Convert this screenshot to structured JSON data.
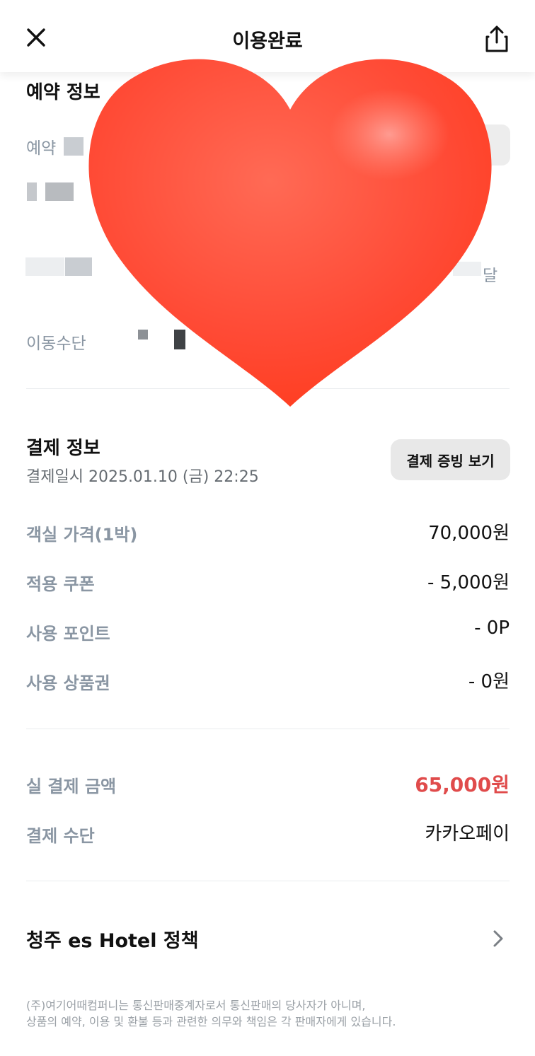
{
  "header": {
    "title": "이용완료",
    "close_icon": "close-icon",
    "share_icon": "share-icon"
  },
  "reservation": {
    "section_title": "예약 정보",
    "label_reservation_partial": "예약",
    "label_transport": "이동수단",
    "right_text_partial": "달"
  },
  "payment": {
    "section_title": "결제 정보",
    "paid_at": "결제일시 2025.01.10 (금) 22:25",
    "proof_button": "결제 증빙 보기",
    "rows": [
      {
        "label": "객실 가격(1박)",
        "value": "70,000원"
      },
      {
        "label": "적용 쿠폰",
        "value": "- 5,000원"
      },
      {
        "label": "사용 포인트",
        "value": "- 0P"
      },
      {
        "label": "사용 상품권",
        "value": "- 0원"
      }
    ],
    "total_label": "실 결제 금액",
    "total_value": "65,000원",
    "method_label": "결제 수단",
    "method_value": "카카오페이"
  },
  "policy": {
    "label": "청주 es Hotel 정책",
    "chevron_icon": "chevron-right-icon"
  },
  "footnote": {
    "line1": "(주)여기어때컴퍼니는 통신판매중계자로서 통신판매의 당사자가 아니며,",
    "line2": "상품의 예약, 이용 및 환불 등과 관련한 의무와 책임은 각 판매자에게 있습니다."
  },
  "overlay": {
    "sticker": "red-heart-sticker"
  },
  "colors": {
    "total_red": "#e04b4b",
    "label_gray": "#8a96a3",
    "heart_red": "#ff4a35"
  }
}
